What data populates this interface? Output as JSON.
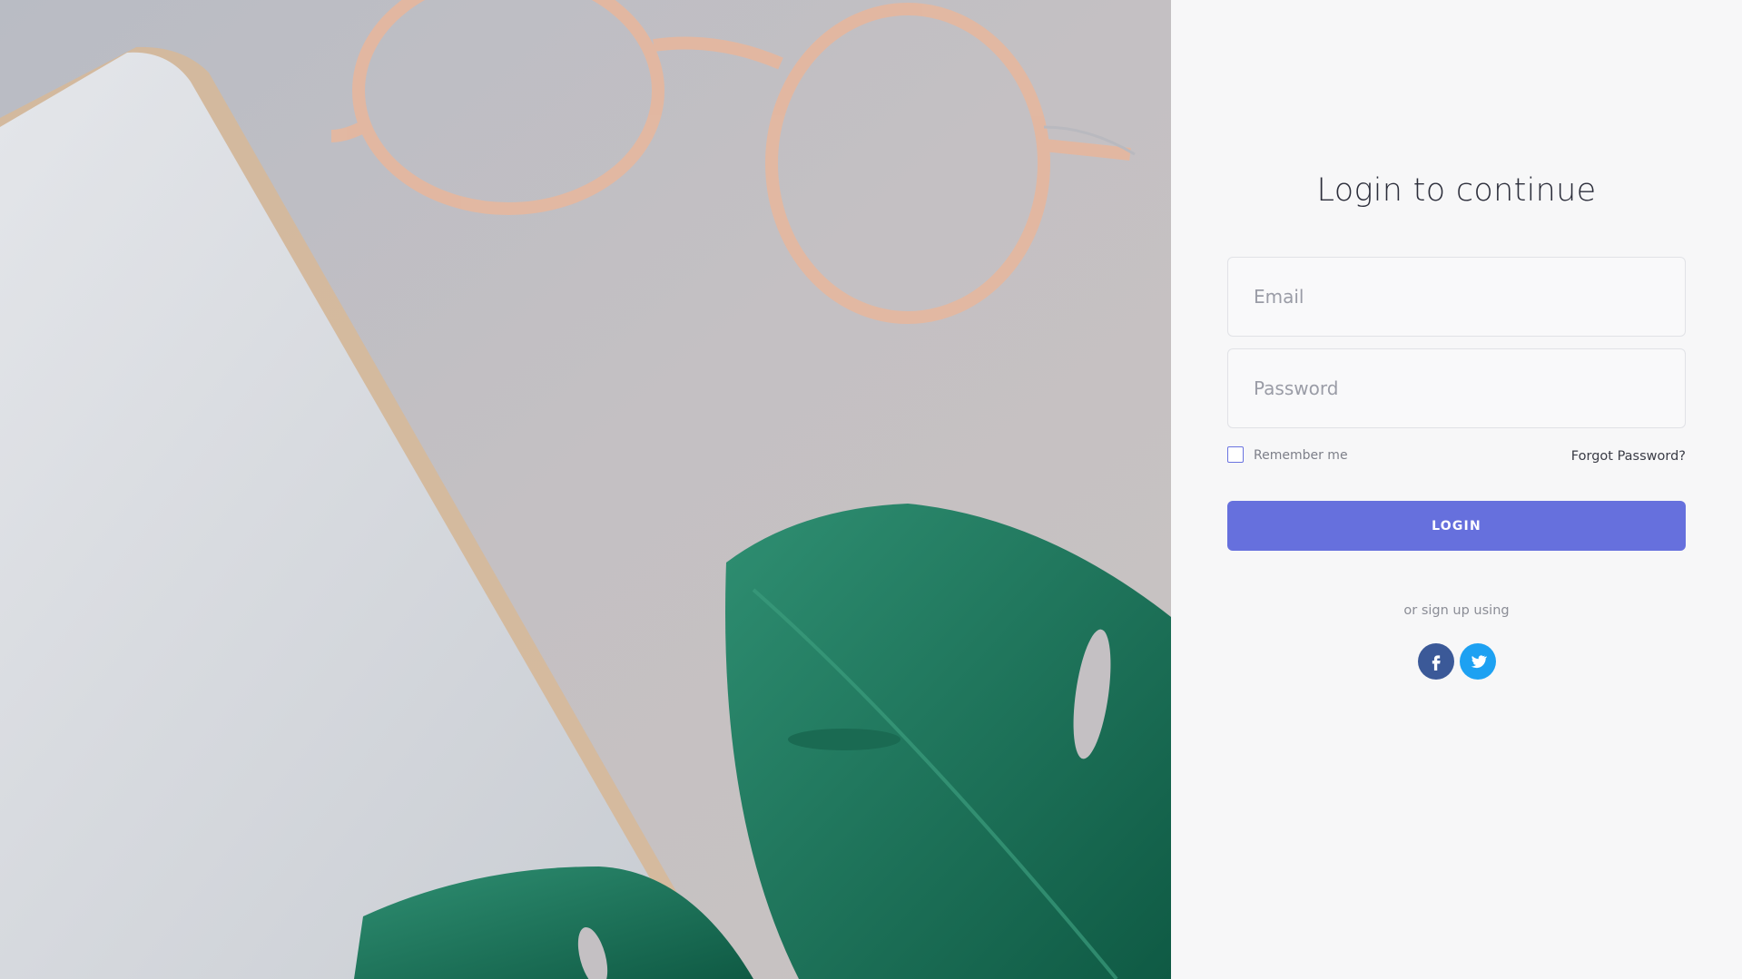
{
  "login": {
    "title": "Login to continue",
    "email_placeholder": "Email",
    "password_placeholder": "Password",
    "remember_label": "Remember me",
    "forgot_label": "Forgot Password?",
    "login_label": "LOGIN",
    "signup_text": "or sign up using"
  },
  "social": [
    {
      "name": "facebook",
      "icon": "facebook-icon",
      "color": "#3b5998"
    },
    {
      "name": "twitter",
      "icon": "twitter-icon",
      "color": "#1da1f2"
    }
  ],
  "colors": {
    "accent": "#6670dd",
    "panel_bg": "#f7f7f8"
  }
}
